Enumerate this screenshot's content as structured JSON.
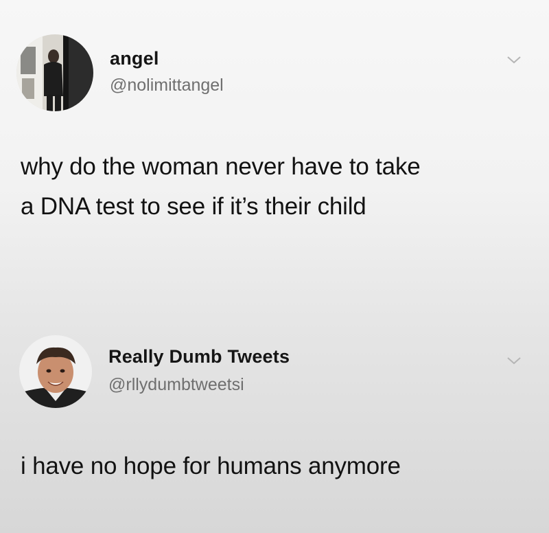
{
  "tweets": [
    {
      "display_name": "angel",
      "handle": "@nolimittangel",
      "text_lines": [
        "why do the woman never have to take",
        "a DNA test to see if it’s their child"
      ],
      "avatar_icon": "profile-photo-person",
      "menu_icon": "chevron-down-icon"
    },
    {
      "display_name": "Really Dumb Tweets",
      "handle": "@rllydumbtweetsi",
      "text_lines": [
        "i have no hope for humans anymore"
      ],
      "avatar_icon": "profile-photo-face",
      "menu_icon": "chevron-down-icon"
    }
  ],
  "colors": {
    "name": "#151515",
    "handle": "#6f6f6f",
    "text": "#121212",
    "chevron": "#b5b5b5"
  }
}
